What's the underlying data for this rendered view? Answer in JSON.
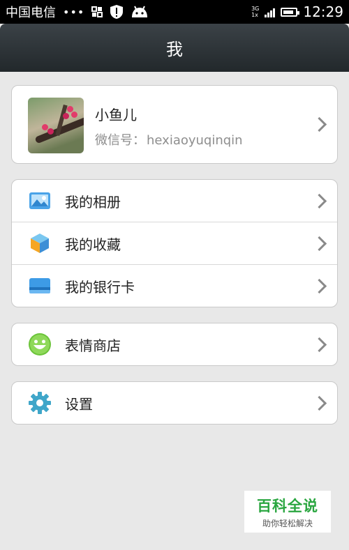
{
  "status_bar": {
    "carrier": "中国电信",
    "dots": "•••",
    "network": [
      "3G",
      "1x"
    ],
    "time": "12:29"
  },
  "header": {
    "title": "我"
  },
  "profile": {
    "name": "小鱼儿",
    "wechat_id_label": "微信号：",
    "wechat_id": "hexiaoyuqinqin"
  },
  "menu_group_1": [
    {
      "label": "我的相册",
      "icon": "photo-album-icon"
    },
    {
      "label": "我的收藏",
      "icon": "favorites-cube-icon"
    },
    {
      "label": "我的银行卡",
      "icon": "bank-card-icon"
    }
  ],
  "menu_group_2": [
    {
      "label": "表情商店",
      "icon": "smiley-icon"
    }
  ],
  "menu_group_3": [
    {
      "label": "设置",
      "icon": "gear-icon"
    }
  ],
  "watermark": {
    "title": "百科全说",
    "subtitle": "助你轻松解决"
  },
  "colors": {
    "header_bg": "#2b3236",
    "page_bg": "#e8e8e8",
    "watermark_green": "#2aa640"
  }
}
